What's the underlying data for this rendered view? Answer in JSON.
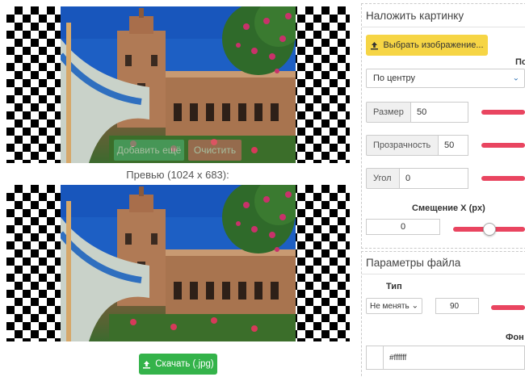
{
  "canvas": {
    "overlay_add_label": "Добавить ещё",
    "overlay_clear_label": "Очистить"
  },
  "preview": {
    "label": "Превью (1024 x 683):",
    "download_label": "Скачать (.jpg)"
  },
  "overlay_panel": {
    "title": "Наложить картинку",
    "choose_image_label": "Выбрать изображение...",
    "position_label": "По",
    "position_value": "По центру",
    "size_label": "Размер",
    "size_value": "50",
    "opacity_label": "Прозрачность",
    "opacity_value": "50",
    "angle_label": "Угол",
    "angle_value": "0",
    "offset_x_label": "Смещение X (px)",
    "offset_x_value": "0"
  },
  "file_panel": {
    "title": "Параметры файла",
    "type_label": "Тип",
    "type_value": "Не менять",
    "quality_value": "90",
    "bg_label": "Фон",
    "bg_value": "#ffffff"
  },
  "colors": {
    "download_green": "#34b34a",
    "choose_yellow": "#f6d545",
    "slider_red": "#e94560"
  }
}
